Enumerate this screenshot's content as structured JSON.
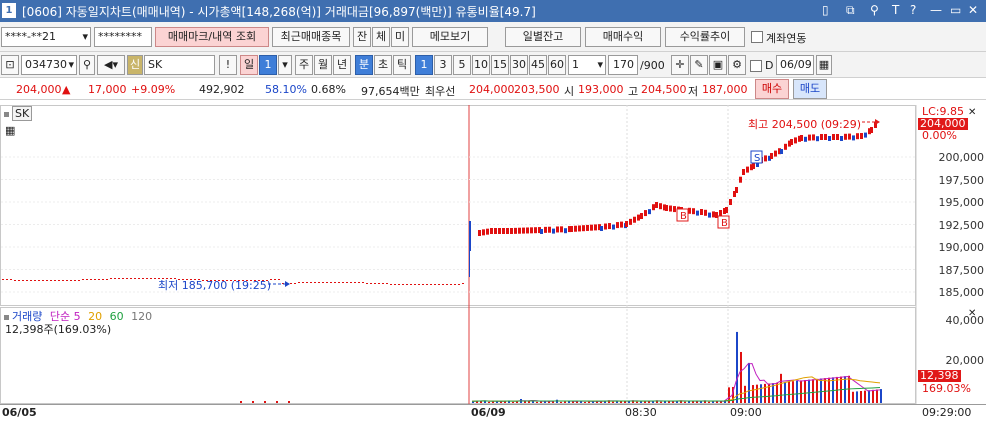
{
  "title_bar": {
    "icon": "1",
    "text": "[0606] 자동일지차트(매매내역) - 시가총액[148,268(억)] 거래대금[96,897(백만)] 유통비율[49.7]",
    "controls": [
      "▯",
      "⧉",
      "⚲",
      "T",
      "?",
      "—",
      "▭",
      "✕"
    ]
  },
  "toolbar1": {
    "account": "****-**21",
    "password": "********",
    "btn_trade_mark": "매매마크/내역 조회",
    "btn_recent": "최근매매종목",
    "btn_jan": "잔",
    "btn_che": "체",
    "btn_mi": "미",
    "btn_memo": "메모보기",
    "btn_daily_bal": "일별잔고",
    "btn_trade_profit": "매매수익",
    "btn_return_trend": "수익률추이",
    "chk_account_link": "계좌연동"
  },
  "toolbar2": {
    "code": "034730",
    "credit_label": "신",
    "stock_name": "SK",
    "bang": "!",
    "period_label": "일",
    "period_value": "1",
    "periods": [
      "주",
      "월",
      "년",
      "분",
      "초",
      "틱"
    ],
    "intervals": [
      "1",
      "3",
      "5",
      "10",
      "15",
      "30",
      "45",
      "60"
    ],
    "count": "1",
    "range": "170",
    "range_total": "/900",
    "date_label": "D",
    "date_value": "06/09"
  },
  "quote": {
    "price": "204,000",
    "arrow": "▲",
    "change": "17,000",
    "rate": "+9.09%",
    "volume": "492,902",
    "vol_ratio": "58.10%",
    "turnover": "0.68%",
    "value": "97,654백만",
    "best_label": "최우선",
    "ask": "204,000",
    "bid": "203,500",
    "open_label": "시",
    "open": "193,000",
    "high_label": "고",
    "high": "204,500",
    "low_label": "저",
    "low": "187,000",
    "buy": "매수",
    "sell": "매도"
  },
  "price_chart": {
    "symbol": "SK",
    "high_note": "최고 204,500 (09:29)",
    "low_note": "최저 185,700 (19:25)",
    "lc_label": "LC:9.85",
    "current_tag": "204,000",
    "pct_tag": "0.00%",
    "y_ticks": [
      "200,000",
      "197,500",
      "195,000",
      "192,500",
      "190,000",
      "187,500",
      "185,000"
    ],
    "marker_b": "B",
    "marker_s": "S"
  },
  "volume_chart": {
    "legend": {
      "title": "거래량",
      "ma_label": "단순",
      "ma_values": [
        "5",
        "20",
        "60",
        "120"
      ]
    },
    "info": "12,398주(169.03%)",
    "y_ticks": [
      "40,000",
      "20,000"
    ],
    "current_tag": "12,398",
    "pct_tag": "169.03%"
  },
  "x_axis": {
    "labels": [
      "06/05",
      "06/09",
      "08:30",
      "09:00"
    ],
    "right": "09:29:00"
  },
  "colors": {
    "up": "#e01010",
    "down": "#1b46c8",
    "accent": "#3f6fb0"
  },
  "chart_data": {
    "type": "candlestick",
    "title": "SK",
    "y_range": [
      184000,
      205500
    ],
    "high": 204500,
    "high_time": "09:29",
    "low": 185700,
    "low_time": "19:25",
    "last": 204000,
    "open": 193000,
    "volume_last": 12398,
    "volume_ylim": [
      0,
      45000
    ]
  }
}
